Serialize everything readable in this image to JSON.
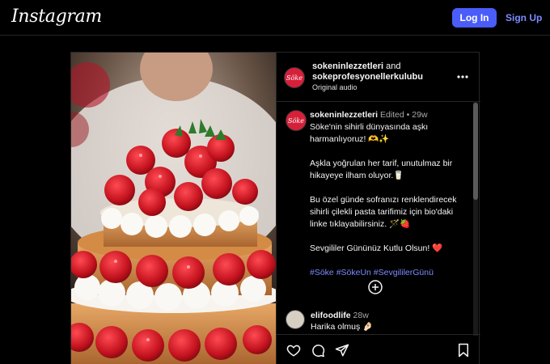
{
  "header": {
    "logo": "Instagram",
    "login_label": "Log In",
    "signup_label": "Sign Up"
  },
  "post": {
    "author": "sokeninlezzetleri",
    "and_text": " and",
    "coauthor": "sokeprofesyonellerkulubu",
    "audio": "Original audio",
    "avatar_text": "Söke",
    "image_alt": "Strawberry layer cake with whipped cream",
    "caption": {
      "author": "sokeninlezzetleri",
      "edited": "Edited",
      "dot": "•",
      "time": "29w",
      "lines": [
        "Söke'nin sihirli dünyasında aşkı harmanlıyoruz! 🫶✨",
        "Aşkla yoğrulan her tarif, unutulmaz bir hikayeye ilham oluyor.🥛",
        "Bu özel günde sofranızı renklendirecek sihirli çilekli pasta tarifimiz için bio'daki linke tıklayabilirsiniz. 🪄🍓",
        "Sevgililer Gününüz Kutlu Olsun! ❤️"
      ],
      "hashtags": "#Söke #SökeUn #SevgililerGünü"
    },
    "comment": {
      "author": "elifoodlife",
      "time": "28w",
      "text": "Harika olmuş 🤌🏻"
    }
  },
  "colors": {
    "accent": "#4a5df9",
    "link": "#7b8cff",
    "brand_avatar": "#d6203a"
  },
  "icons": {
    "more": "more-horizontal-icon",
    "load_more": "plus-circle-icon",
    "like": "heart-icon",
    "comment": "comment-icon",
    "share": "send-icon",
    "save": "bookmark-icon"
  }
}
